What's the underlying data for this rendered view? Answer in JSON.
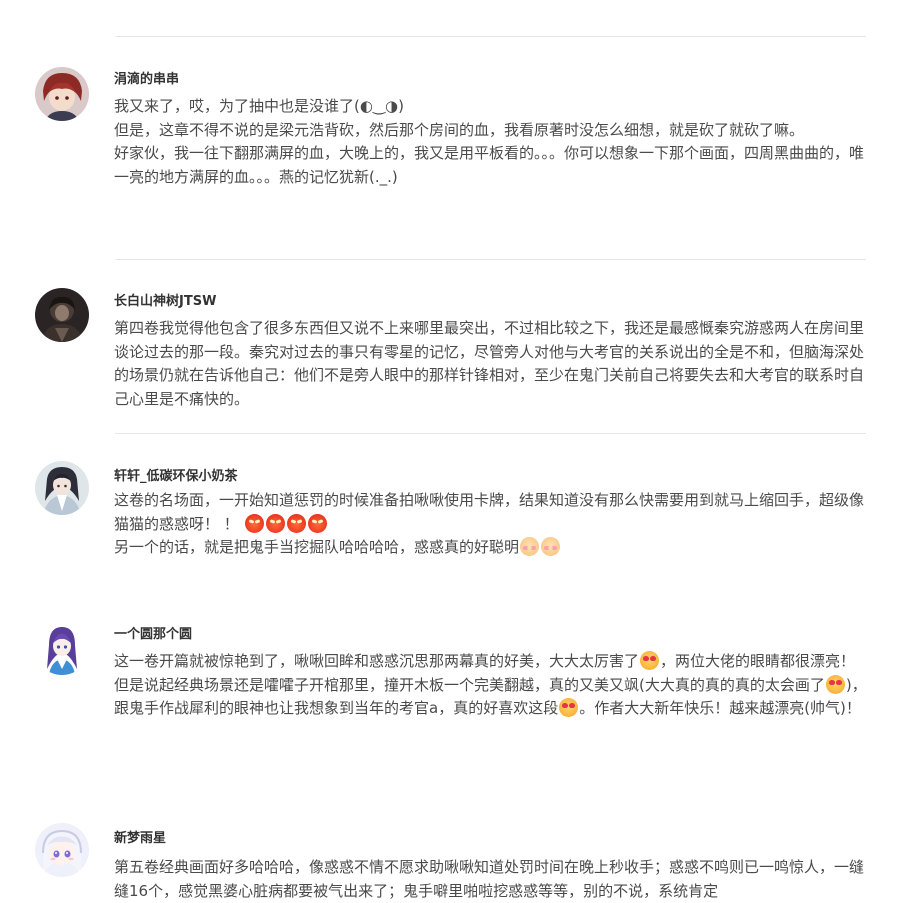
{
  "colors": {
    "background": "#ffffff",
    "username": "#333333",
    "text": "#4a4a4a",
    "divider": "#e6e6e6"
  },
  "comments": [
    {
      "username": "涓滴的串串",
      "avatar": "avatar-red-hair-boy",
      "paragraphs": [
        "我又来了，哎，为了抽中也是没谁了(◐‿◑)",
        "但是，这章不得不说的是梁元浩背砍，然后那个房间的血，我看原著时没怎么细想，就是砍了就砍了嘛。",
        "好家伙，我一往下翻那满屏的血，大晚上的，我又是用平板看的。。。你可以想象一下那个画面，四周黑曲曲的，唯一亮的地方满屏的血。。。燕的记忆犹新(._.)"
      ]
    },
    {
      "username": "长白山神树JTSW",
      "avatar": "avatar-dark-figure",
      "paragraphs": [
        "第四卷我觉得他包含了很多东西但又说不上来哪里最突出，不过相比较之下，我还是最感慨秦究游惑两人在房间里谈论过去的那一段。秦究对过去的事只有零星的记忆，尽管旁人对他与大考官的关系说出的全是不和，但脑海深处的场景仍就在告诉他自己：他们不是旁人眼中的那样针锋相对，至少在鬼门关前自己将要失去和大考官的联系时自己心里是不痛快的。"
      ]
    },
    {
      "username": "轩轩_低碳环保小奶茶",
      "avatar": "avatar-ancient-scholar",
      "paragraphs": [
        "这卷的名场面，一开始知道惩罚的时候准备拍啾啾使用卡牌，结果知道没有那么快需要用到就马上缩回手，超级像猫猫的惑惑呀！ ！ [rage][rage][rage][rage]",
        "另一个的话，就是把鬼手当挖掘队哈哈哈哈，惑惑真的好聪明[blush][blush]"
      ]
    },
    {
      "username": "一个圆那个圆",
      "avatar": "avatar-anime-purple-hair",
      "paragraphs": [
        "这一卷开篇就被惊艳到了，啾啾回眸和惑惑沉思那两幕真的好美，大大太厉害了[love]，两位大佬的眼睛都很漂亮！",
        "但是说起经典场景还是嚯嚯子开棺那里，撞开木板一个完美翻越，真的又美又飒(大大真的真的真的太会画了[love])，跟鬼手作战犀利的眼神也让我想象到当年的考官a，真的好喜欢这段[love]。作者大大新年快乐！越来越漂亮(帅气)！"
      ]
    },
    {
      "username": "新梦雨星",
      "avatar": "avatar-anime-white-hair",
      "paragraphs": [
        "第五卷经典画面好多哈哈哈，像惑惑不情不愿求助啾啾知道处罚时间在晚上秒收手；惑惑不鸣则已一鸣惊人，一缝缝16个，感觉黑婆心脏病都要被气出来了；鬼手噼里啪啦挖惑惑等等，别的不说，系统肯定"
      ]
    }
  ]
}
